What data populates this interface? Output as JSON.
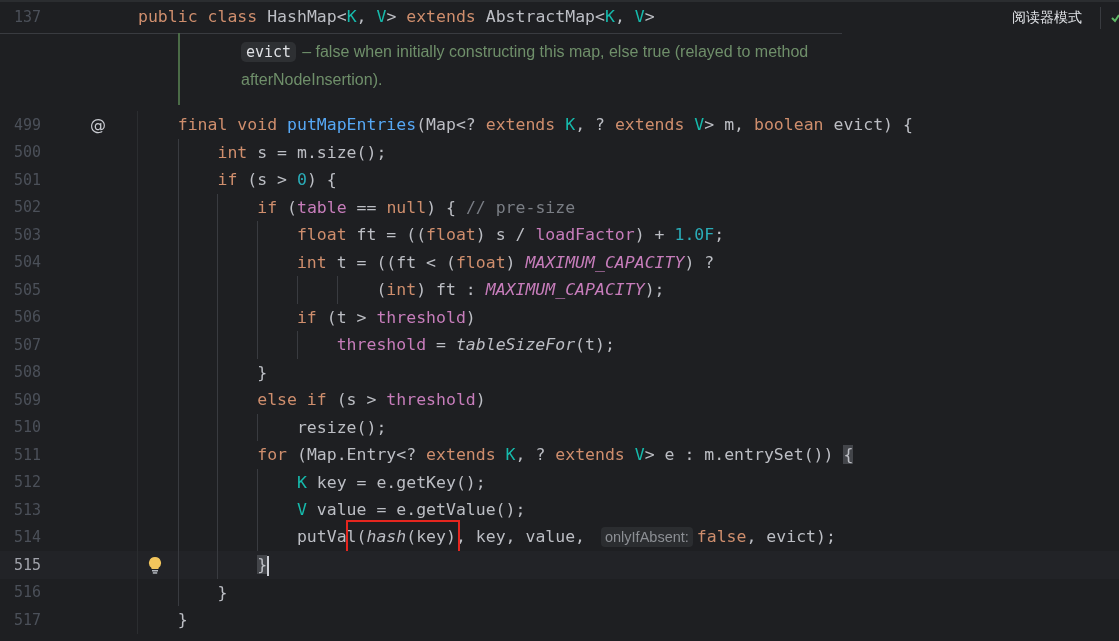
{
  "sticky_header": {
    "line_number": "137",
    "tokens": [
      {
        "kind": "kw",
        "text": "public class "
      },
      {
        "kind": "plain",
        "text": "HashMap<"
      },
      {
        "kind": "type",
        "text": "K"
      },
      {
        "kind": "plain",
        "text": ", "
      },
      {
        "kind": "type",
        "text": "V"
      },
      {
        "kind": "plain",
        "text": "> "
      },
      {
        "kind": "kw",
        "text": "extends "
      },
      {
        "kind": "plain",
        "text": "AbstractMap<"
      },
      {
        "kind": "type",
        "text": "K"
      },
      {
        "kind": "plain",
        "text": ", "
      },
      {
        "kind": "type",
        "text": "V"
      },
      {
        "kind": "plain",
        "text": ">"
      }
    ]
  },
  "reader_mode": {
    "label": "阅读器模式"
  },
  "doc": {
    "entries": [
      {
        "param": "evict",
        "lines": [
          "– false when initially constructing this map, else true (relayed to method",
          "afterNodeInsertion)."
        ]
      }
    ]
  },
  "lines": [
    {
      "number": "499",
      "current": false,
      "gutter": {
        "kind": "text",
        "text": "@"
      },
      "tokens": [
        {
          "kind": "kw",
          "text": "    final void "
        },
        {
          "kind": "decl",
          "text": "putMapEntries"
        },
        {
          "kind": "plain",
          "text": "(Map<? "
        },
        {
          "kind": "kw",
          "text": "extends "
        },
        {
          "kind": "type",
          "text": "K"
        },
        {
          "kind": "plain",
          "text": ", ? "
        },
        {
          "kind": "kw",
          "text": "extends "
        },
        {
          "kind": "type",
          "text": "V"
        },
        {
          "kind": "plain",
          "text": "> m, "
        },
        {
          "kind": "kw",
          "text": "boolean "
        },
        {
          "kind": "plain",
          "text": "evict) {"
        }
      ]
    },
    {
      "number": "500",
      "current": false,
      "tokens": [
        {
          "kind": "kw",
          "text": "        int "
        },
        {
          "kind": "plain",
          "text": "s = m.size();"
        }
      ]
    },
    {
      "number": "501",
      "current": false,
      "tokens": [
        {
          "kind": "kw",
          "text": "        if "
        },
        {
          "kind": "plain",
          "text": "(s > "
        },
        {
          "kind": "num",
          "text": "0"
        },
        {
          "kind": "plain",
          "text": ") {"
        }
      ]
    },
    {
      "number": "502",
      "current": false,
      "tokens": [
        {
          "kind": "kw",
          "text": "            if "
        },
        {
          "kind": "plain",
          "text": "("
        },
        {
          "kind": "field",
          "text": "table"
        },
        {
          "kind": "plain",
          "text": " == "
        },
        {
          "kind": "kw",
          "text": "null"
        },
        {
          "kind": "plain",
          "text": ") { "
        },
        {
          "kind": "comment",
          "text": "// pre-size"
        }
      ]
    },
    {
      "number": "503",
      "current": false,
      "tokens": [
        {
          "kind": "kw",
          "text": "                float "
        },
        {
          "kind": "plain",
          "text": "ft = (("
        },
        {
          "kind": "kw",
          "text": "float"
        },
        {
          "kind": "plain",
          "text": ") s / "
        },
        {
          "kind": "field",
          "text": "loadFactor"
        },
        {
          "kind": "plain",
          "text": ") + "
        },
        {
          "kind": "num",
          "text": "1.0F"
        },
        {
          "kind": "plain",
          "text": ";"
        }
      ]
    },
    {
      "number": "504",
      "current": false,
      "tokens": [
        {
          "kind": "kw",
          "text": "                int "
        },
        {
          "kind": "plain",
          "text": "t = ((ft < ("
        },
        {
          "kind": "kw",
          "text": "float"
        },
        {
          "kind": "plain",
          "text": ") "
        },
        {
          "kind": "const",
          "text": "MAXIMUM_CAPACITY"
        },
        {
          "kind": "plain",
          "text": ") ?"
        }
      ]
    },
    {
      "number": "505",
      "current": false,
      "tokens": [
        {
          "kind": "plain",
          "text": "                        ("
        },
        {
          "kind": "kw",
          "text": "int"
        },
        {
          "kind": "plain",
          "text": ") ft : "
        },
        {
          "kind": "const",
          "text": "MAXIMUM_CAPACITY"
        },
        {
          "kind": "plain",
          "text": ");"
        }
      ]
    },
    {
      "number": "506",
      "current": false,
      "tokens": [
        {
          "kind": "kw",
          "text": "                if "
        },
        {
          "kind": "plain",
          "text": "(t > "
        },
        {
          "kind": "field",
          "text": "threshold"
        },
        {
          "kind": "plain",
          "text": ")"
        }
      ]
    },
    {
      "number": "507",
      "current": false,
      "tokens": [
        {
          "kind": "field",
          "text": "                    threshold"
        },
        {
          "kind": "plain",
          "text": " = "
        },
        {
          "kind": "italic",
          "text": "tableSizeFor"
        },
        {
          "kind": "plain",
          "text": "(t);"
        }
      ]
    },
    {
      "number": "508",
      "current": false,
      "tokens": [
        {
          "kind": "plain",
          "text": "            }"
        }
      ]
    },
    {
      "number": "509",
      "current": false,
      "tokens": [
        {
          "kind": "kw",
          "text": "            else if "
        },
        {
          "kind": "plain",
          "text": "(s > "
        },
        {
          "kind": "field",
          "text": "threshold"
        },
        {
          "kind": "plain",
          "text": ")"
        }
      ]
    },
    {
      "number": "510",
      "current": false,
      "tokens": [
        {
          "kind": "plain",
          "text": "                resize();"
        }
      ]
    },
    {
      "number": "511",
      "current": false,
      "tokens": [
        {
          "kind": "kw",
          "text": "            for "
        },
        {
          "kind": "plain",
          "text": "(Map.Entry<? "
        },
        {
          "kind": "kw",
          "text": "extends "
        },
        {
          "kind": "type",
          "text": "K"
        },
        {
          "kind": "plain",
          "text": ", ? "
        },
        {
          "kind": "kw",
          "text": "extends "
        },
        {
          "kind": "type",
          "text": "V"
        },
        {
          "kind": "plain",
          "text": "> e : m.entrySet()) "
        },
        {
          "kind": "match",
          "text": "{"
        }
      ]
    },
    {
      "number": "512",
      "current": false,
      "tokens": [
        {
          "kind": "type",
          "text": "                K"
        },
        {
          "kind": "plain",
          "text": " key = e.getKey();"
        }
      ]
    },
    {
      "number": "513",
      "current": false,
      "tokens": [
        {
          "kind": "type",
          "text": "                V"
        },
        {
          "kind": "plain",
          "text": " value = e.getValue();"
        }
      ]
    },
    {
      "number": "514",
      "current": false,
      "tokens": [
        {
          "kind": "plain",
          "text": "                putVa"
        },
        {
          "kind": "plain",
          "text": "l(",
          "boxed": true
        },
        {
          "kind": "italic",
          "text": "hash",
          "boxed": true
        },
        {
          "kind": "plain",
          "text": "(key)",
          "boxed": true
        },
        {
          "kind": "plain",
          "text": ", key, value, "
        },
        {
          "kind": "hint",
          "text": "onlyIfAbsent:"
        },
        {
          "kind": "kw",
          "text": "false"
        },
        {
          "kind": "plain",
          "text": ", evict);"
        }
      ]
    },
    {
      "number": "515",
      "current": true,
      "gutter": {
        "kind": "bulb"
      },
      "tokens": [
        {
          "kind": "match",
          "text": "            }"
        }
      ]
    },
    {
      "number": "516",
      "current": false,
      "tokens": [
        {
          "kind": "plain",
          "text": "        }"
        }
      ]
    },
    {
      "number": "517",
      "current": false,
      "tokens": [
        {
          "kind": "plain",
          "text": "    }"
        }
      ]
    }
  ]
}
